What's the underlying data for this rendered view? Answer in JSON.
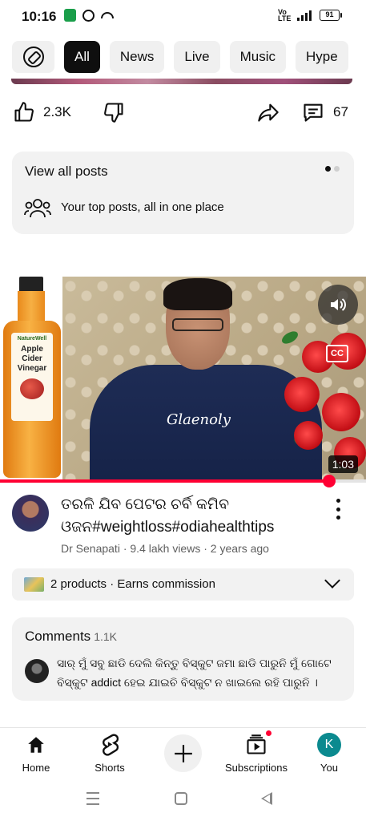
{
  "status_bar": {
    "time": "10:16",
    "network": "4G",
    "volte": "Vo LTE",
    "battery": "91"
  },
  "chips": [
    "All",
    "News",
    "Live",
    "Music",
    "Hype"
  ],
  "actions": {
    "likes": "2.3K",
    "comments": "67"
  },
  "posts_card": {
    "title": "View all posts",
    "subtitle": "Your top posts, all in one place"
  },
  "video": {
    "duration": "1:03",
    "progress": 0.9,
    "title": "ତରଳି ଯିବ ପେଟର ଚର୍ବି କମିବ ଓଜନ#weightloss#odiahealthtips",
    "channel": "Dr Senapati",
    "views": "9.4 lakh views",
    "age": "2 years ago",
    "sep": " · ",
    "thumb_product": {
      "brand": "NatureWell",
      "name": "Apple Cider Vinegar"
    },
    "shirt_text": "Glaenoly",
    "cc_label": "CC"
  },
  "products": {
    "count_label": "2 products",
    "commission": "Earns commission",
    "sep": " · "
  },
  "comments": {
    "heading": "Comments",
    "count": "1.1K",
    "top_comment": "ସାର୍ ମୁଁ ସବୁ ଛାଡି ଦେଲି କିନ୍ତୁ ବିସ୍କୁଟ ଜମା ଛାଡି ପାରୁନି ମୁଁ ଗୋଟେ ବିସ୍କୁଟ addict ହେଇ ଯାଇଚି ବିସ୍କୁଟ ନ ଖାଇଲେ ରହି ପାରୁନି ।"
  },
  "bottom_nav": {
    "home": "Home",
    "shorts": "Shorts",
    "subscriptions": "Subscriptions",
    "you": "You",
    "you_initial": "K"
  },
  "colors": {
    "accent_red": "#ff0033",
    "avatar_teal": "#0b8a8f",
    "chip_bg": "#f0f0f0"
  }
}
